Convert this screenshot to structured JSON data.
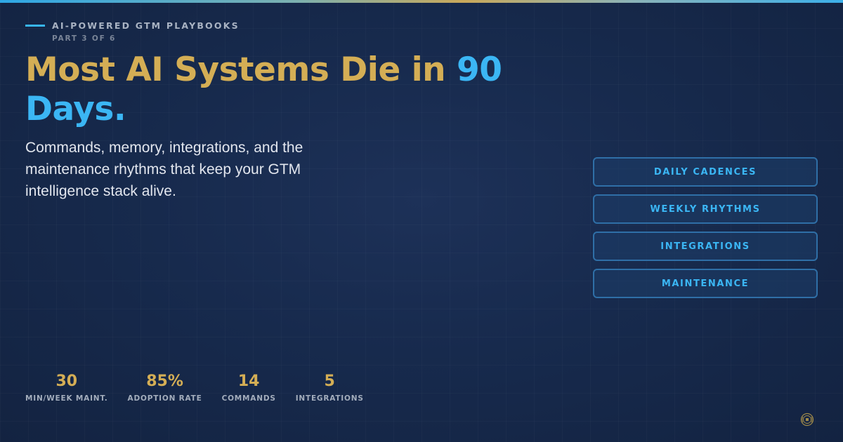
{
  "header": {
    "kicker": "AI-POWERED GTM PLAYBOOKS",
    "part": "PART 3 OF 6"
  },
  "headline": {
    "part1": "Most AI Systems Die in ",
    "highlight1": "90",
    "highlight2": "Days."
  },
  "subtitle": "Commands, memory, integrations, and the maintenance rhythms that keep your GTM intelligence stack alive.",
  "pills": [
    {
      "label": "DAILY CADENCES"
    },
    {
      "label": "WEEKLY RHYTHMS"
    },
    {
      "label": "INTEGRATIONS"
    },
    {
      "label": "MAINTENANCE"
    }
  ],
  "stats": [
    {
      "value": "30",
      "label": "MIN/WEEK MAINT."
    },
    {
      "value": "85%",
      "label": "ADOPTION RATE"
    },
    {
      "value": "14",
      "label": "COMMANDS"
    },
    {
      "value": "5",
      "label": "INTEGRATIONS"
    }
  ],
  "colors": {
    "background": "#172a4d",
    "accent_gold": "#d4ae55",
    "accent_blue": "#3bb6f4",
    "pill_border": "#2f6fa7"
  },
  "icons": {
    "seal": "gtm-seal-icon"
  }
}
